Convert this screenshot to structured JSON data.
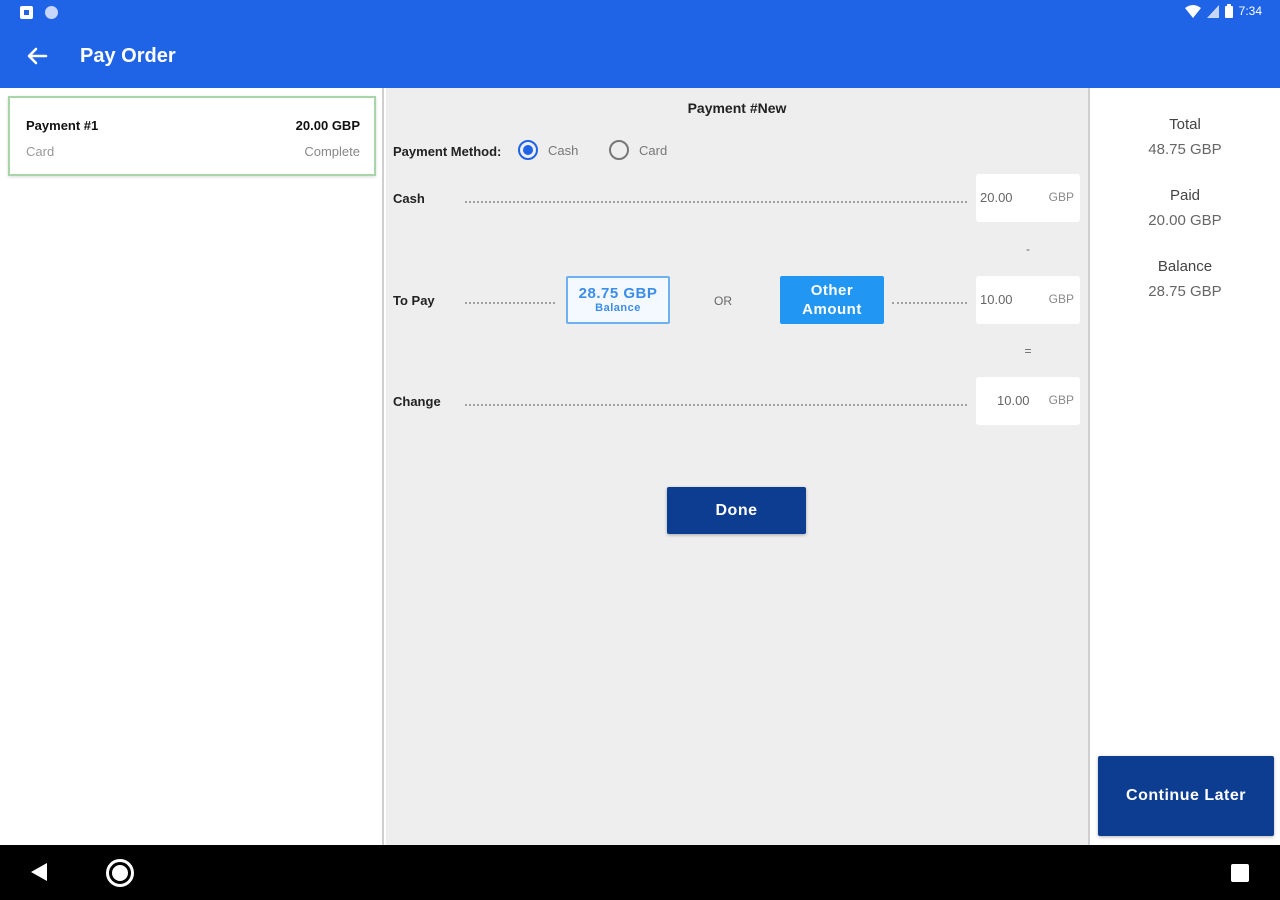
{
  "status_bar": {
    "time": "7:34",
    "icons": [
      "notification-icon",
      "sync-icon",
      "wifi-icon",
      "signal-icon",
      "battery-icon"
    ]
  },
  "app_bar": {
    "title": "Pay Order",
    "back_icon": "arrow-back-icon"
  },
  "payments": [
    {
      "title": "Payment #1",
      "amount": "20.00 GBP",
      "method": "Card",
      "status": "Complete"
    }
  ],
  "form": {
    "heading": "Payment #New",
    "payment_method_label": "Payment Method:",
    "methods": [
      {
        "label": "Cash",
        "selected": true
      },
      {
        "label": "Card",
        "selected": false
      }
    ],
    "cash": {
      "label": "Cash",
      "value": "20.00",
      "currency": "GBP"
    },
    "minus_sign": "-",
    "to_pay": {
      "label": "To Pay",
      "balance_amount": "28.75 GBP",
      "balance_sub": "Balance",
      "or_text": "OR",
      "other_amount_label": "Other Amount",
      "value": "10.00",
      "currency": "GBP"
    },
    "equals_sign": "=",
    "change": {
      "label": "Change",
      "value": "10.00",
      "currency": "GBP"
    },
    "done_label": "Done"
  },
  "summary": {
    "total_label": "Total",
    "total_value": "48.75 GBP",
    "paid_label": "Paid",
    "paid_value": "20.00 GBP",
    "balance_label": "Balance",
    "balance_value": "28.75 GBP",
    "continue_label": "Continue Later"
  },
  "colors": {
    "primary": "#1f63e6",
    "dark_button": "#0d3d91",
    "accent_button": "#2196f3",
    "card_border": "#a9d6a9"
  }
}
